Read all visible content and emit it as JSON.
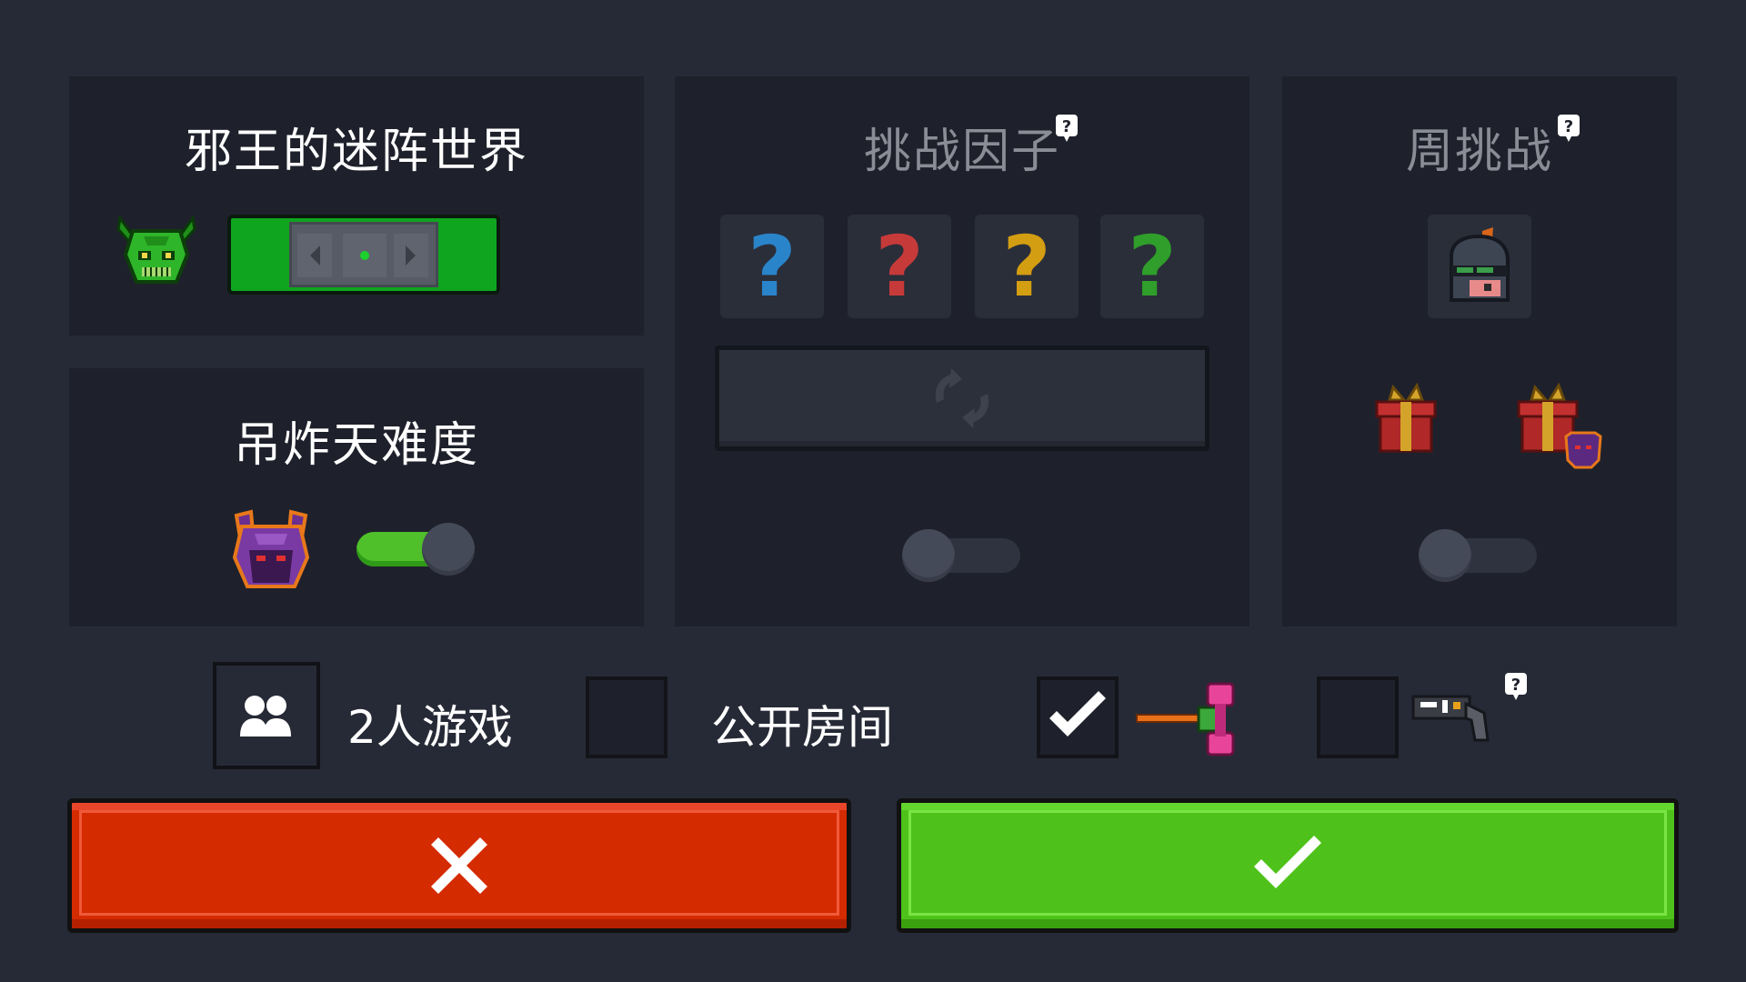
{
  "world": {
    "title": "邪王的迷阵世界",
    "boss_icon": "green-horned-demon-skull-icon",
    "stage_selector_color": "#0fa51f"
  },
  "difficulty": {
    "title": "吊炸天难度",
    "icon": "purple-demon-helmet-icon",
    "toggle_on": true
  },
  "challenge": {
    "title": "挑战因子",
    "slots": [
      {
        "label": "?",
        "color": "#2a84c9"
      },
      {
        "label": "?",
        "color": "#c73a3a"
      },
      {
        "label": "?",
        "color": "#d49e12"
      },
      {
        "label": "?",
        "color": "#2f9e2a"
      }
    ],
    "reroll_icon": "refresh-icon",
    "toggle_on": false
  },
  "weekly": {
    "title": "周挑战",
    "knight_icon": "knight-helmet-icon",
    "rewards": [
      "gift-box-icon",
      "gift-box-demon-icon"
    ],
    "toggle_on": false
  },
  "options": {
    "two_player": {
      "label": "2人游戏",
      "icon": "two-players-icon"
    },
    "public_room": {
      "label": "公开房间",
      "checked": false
    },
    "weapon_toggle": {
      "checked": true,
      "icon": "pink-hammer-icon"
    },
    "gun_toggle": {
      "checked": false,
      "icon": "gun-icon"
    }
  },
  "buttons": {
    "cancel": {
      "icon": "close-icon",
      "color": "#d52b00"
    },
    "confirm": {
      "icon": "checkmark-icon",
      "color": "#4ec21a"
    }
  }
}
